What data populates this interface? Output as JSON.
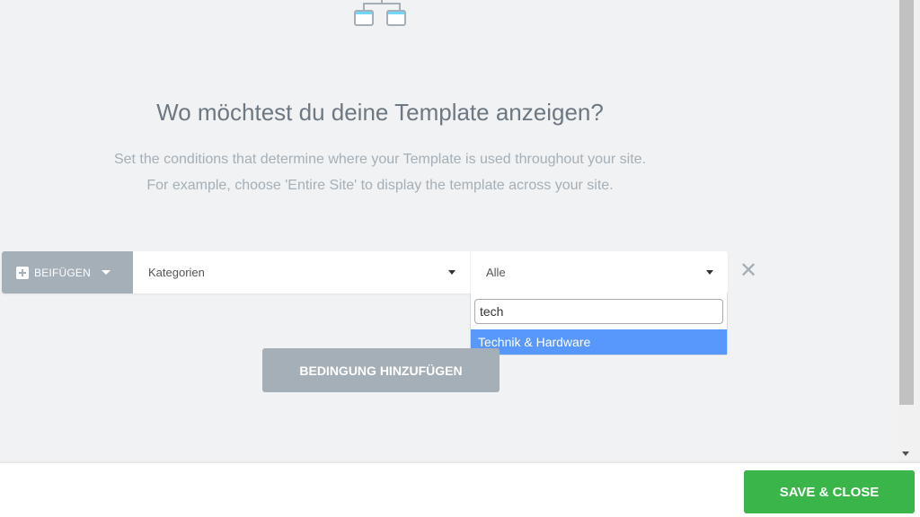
{
  "header": {
    "icon": "conditions-hierarchy-icon",
    "title": "Wo möchtest du deine Template anzeigen?",
    "description_line1": "Set the conditions that determine where your Template is used throughout your site.",
    "description_line2": "For example, choose 'Entire Site' to display the template across your site."
  },
  "condition": {
    "include_label": "BEIFÜGEN",
    "type_value": "Kategorien",
    "scope_value": "Alle",
    "remove_icon": "close-x-icon"
  },
  "dropdown": {
    "search_value": "tech",
    "options": [
      {
        "label": "Technik & Hardware",
        "highlighted": true
      }
    ]
  },
  "actions": {
    "add_condition_label": "BEDINGUNG HINZUFÜGEN",
    "save_close_label": "SAVE & CLOSE"
  },
  "colors": {
    "accent_green": "#39b54a",
    "gray_button": "#a4afb7",
    "highlight_blue": "#5897fb"
  }
}
